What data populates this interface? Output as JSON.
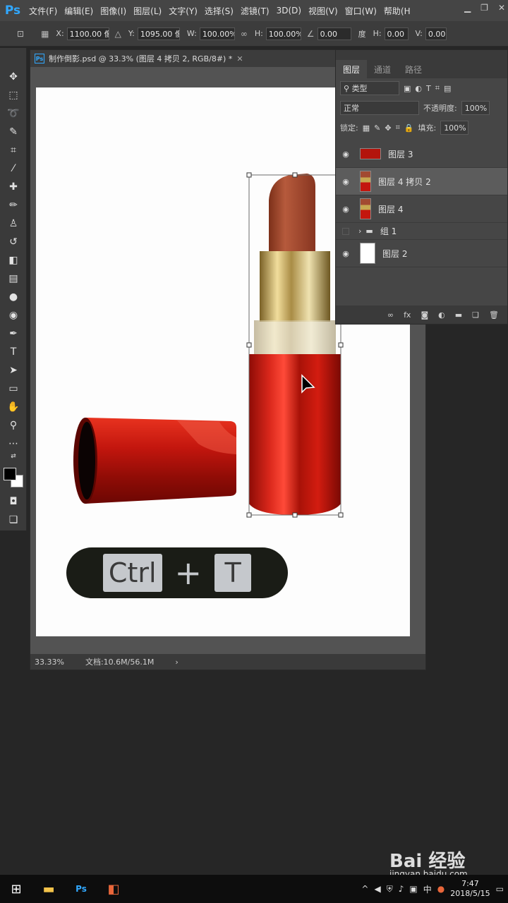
{
  "app": {
    "logo": "Ps"
  },
  "menu": [
    "文件(F)",
    "编辑(E)",
    "图像(I)",
    "图层(L)",
    "文字(Y)",
    "选择(S)",
    "滤镜(T)",
    "3D(D)",
    "视图(V)",
    "窗口(W)",
    "帮助(H"
  ],
  "options": {
    "x_label": "X:",
    "x_value": "1100.00 像",
    "y_label": "Y:",
    "y_value": "1095.00 像",
    "w_label": "W:",
    "w_value": "100.00%",
    "h_label": "H:",
    "h_value": "100.00%",
    "angle_value": "0.00",
    "angle_unit": "度",
    "hskew_label": "H:",
    "hskew_value": "0.00",
    "vskew_label": "V:",
    "vskew_value": "0.00"
  },
  "document": {
    "title": "制作倒影.psd @ 33.3% (图层 4 拷贝 2, RGB/8#) *",
    "zoom": "33.33%",
    "doc_size": "文档:10.6M/56.1M"
  },
  "shortcut": {
    "key1": "Ctrl",
    "plus": "+",
    "key2": "T"
  },
  "layers_panel": {
    "tabs": [
      "图层",
      "通道",
      "路径"
    ],
    "filter_kind": "类型",
    "blend_mode": "正常",
    "opacity_label": "不透明度:",
    "opacity_value": "100%",
    "lock_label": "锁定:",
    "fill_label": "填充:",
    "fill_value": "100%",
    "layers": [
      {
        "name": "图层 3",
        "visible": true,
        "selected": false
      },
      {
        "name": "图层 4 拷贝 2",
        "visible": true,
        "selected": true
      },
      {
        "name": "图层 4",
        "visible": true,
        "selected": false
      },
      {
        "name": "组 1",
        "visible": false,
        "selected": false,
        "group": true
      },
      {
        "name": "图层 2",
        "visible": true,
        "selected": false
      }
    ]
  },
  "taskbar": {
    "ime": "中",
    "time": "7:47",
    "date": "2018/5/15"
  },
  "watermark": {
    "brand": "Bai 经验",
    "url": "jingyan.baidu.com"
  },
  "colors": {
    "accent": "#31a8ff",
    "lipstick_red": "#c3160e",
    "lipstick_tip": "#a24a31",
    "gold": "#c7a850"
  }
}
